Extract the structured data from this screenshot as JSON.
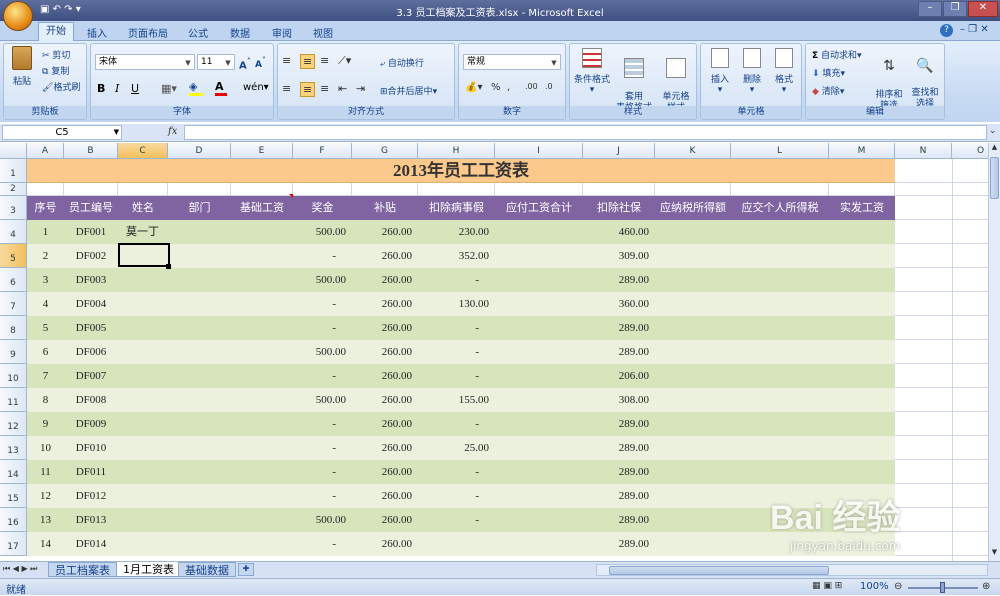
{
  "window": {
    "title": "3.3 员工档案及工资表.xlsx - Microsoft Excel"
  },
  "tabs": [
    "开始",
    "插入",
    "页面布局",
    "公式",
    "数据",
    "审阅",
    "视图"
  ],
  "ribbon": {
    "clipboard": {
      "label": "剪贴板",
      "paste": "粘贴",
      "cut": "剪切",
      "copy": "复制",
      "format_painter": "格式刷"
    },
    "font": {
      "label": "字体",
      "name": "宋体",
      "size": "11"
    },
    "alignment": {
      "label": "对齐方式",
      "wrap": "自动换行",
      "merge": "合并后居中"
    },
    "number": {
      "label": "数字",
      "format": "常规"
    },
    "styles": {
      "label": "样式",
      "conditional": "条件格式",
      "table": "套用\n表格格式",
      "cell_style": "单元格\n样式"
    },
    "cells": {
      "label": "单元格",
      "insert": "插入",
      "delete": "删除",
      "format": "格式"
    },
    "editing": {
      "label": "编辑",
      "autosum": "自动求和",
      "fill": "填充",
      "clear": "清除",
      "sort": "排序和\n筛选",
      "find": "查找和\n选择"
    }
  },
  "formula_bar": {
    "name_box": "C5",
    "fx": "fx",
    "value": ""
  },
  "columns": [
    "A",
    "B",
    "C",
    "D",
    "E",
    "F",
    "G",
    "H",
    "I",
    "J",
    "K",
    "L",
    "M",
    "N",
    "O"
  ],
  "sheet": {
    "title": "2013年员工工资表",
    "headers": [
      "序号",
      "员工编号",
      "姓名",
      "部门",
      "基础工资",
      "奖金",
      "补贴",
      "扣除病事假",
      "应付工资合计",
      "扣除社保",
      "应纳税所得额",
      "应交个人所得税",
      "实发工资"
    ],
    "rows": [
      {
        "num": "1",
        "id": "DF001",
        "name": "莫一丁",
        "bonus": "500.00",
        "allow": "260.00",
        "sick": "230.00",
        "ss": "460.00"
      },
      {
        "num": "2",
        "id": "DF002",
        "name": "",
        "bonus": "-",
        "allow": "260.00",
        "sick": "352.00",
        "ss": "309.00"
      },
      {
        "num": "3",
        "id": "DF003",
        "name": "",
        "bonus": "500.00",
        "allow": "260.00",
        "sick": "-",
        "ss": "289.00"
      },
      {
        "num": "4",
        "id": "DF004",
        "name": "",
        "bonus": "-",
        "allow": "260.00",
        "sick": "130.00",
        "ss": "360.00"
      },
      {
        "num": "5",
        "id": "DF005",
        "name": "",
        "bonus": "-",
        "allow": "260.00",
        "sick": "-",
        "ss": "289.00"
      },
      {
        "num": "6",
        "id": "DF006",
        "name": "",
        "bonus": "500.00",
        "allow": "260.00",
        "sick": "-",
        "ss": "289.00"
      },
      {
        "num": "7",
        "id": "DF007",
        "name": "",
        "bonus": "-",
        "allow": "260.00",
        "sick": "-",
        "ss": "206.00"
      },
      {
        "num": "8",
        "id": "DF008",
        "name": "",
        "bonus": "500.00",
        "allow": "260.00",
        "sick": "155.00",
        "ss": "308.00"
      },
      {
        "num": "9",
        "id": "DF009",
        "name": "",
        "bonus": "-",
        "allow": "260.00",
        "sick": "-",
        "ss": "289.00"
      },
      {
        "num": "10",
        "id": "DF010",
        "name": "",
        "bonus": "-",
        "allow": "260.00",
        "sick": "25.00",
        "ss": "289.00"
      },
      {
        "num": "11",
        "id": "DF011",
        "name": "",
        "bonus": "-",
        "allow": "260.00",
        "sick": "-",
        "ss": "289.00"
      },
      {
        "num": "12",
        "id": "DF012",
        "name": "",
        "bonus": "-",
        "allow": "260.00",
        "sick": "-",
        "ss": "289.00"
      },
      {
        "num": "13",
        "id": "DF013",
        "name": "",
        "bonus": "500.00",
        "allow": "260.00",
        "sick": "-",
        "ss": "289.00"
      },
      {
        "num": "14",
        "id": "DF014",
        "name": "",
        "bonus": "-",
        "allow": "260.00",
        "sick": "",
        "ss": "289.00"
      }
    ],
    "row_numbers": [
      "1",
      "2",
      "3",
      "4",
      "5",
      "6",
      "7",
      "8",
      "9",
      "10",
      "11",
      "12",
      "13",
      "14",
      "15",
      "16",
      "17"
    ]
  },
  "sheet_tabs": [
    "员工档案表",
    "1月工资表",
    "基础数据"
  ],
  "status": {
    "ready": "就绪",
    "zoom": "100%"
  },
  "watermark": {
    "brand": "Bai 经验",
    "url": "jingyan.baidu.com"
  },
  "colors": {
    "title_bg": "#fcc98c",
    "header_bg": "#8064a2",
    "row_dark": "#d7e4bc",
    "row_light": "#ebf1dd"
  }
}
